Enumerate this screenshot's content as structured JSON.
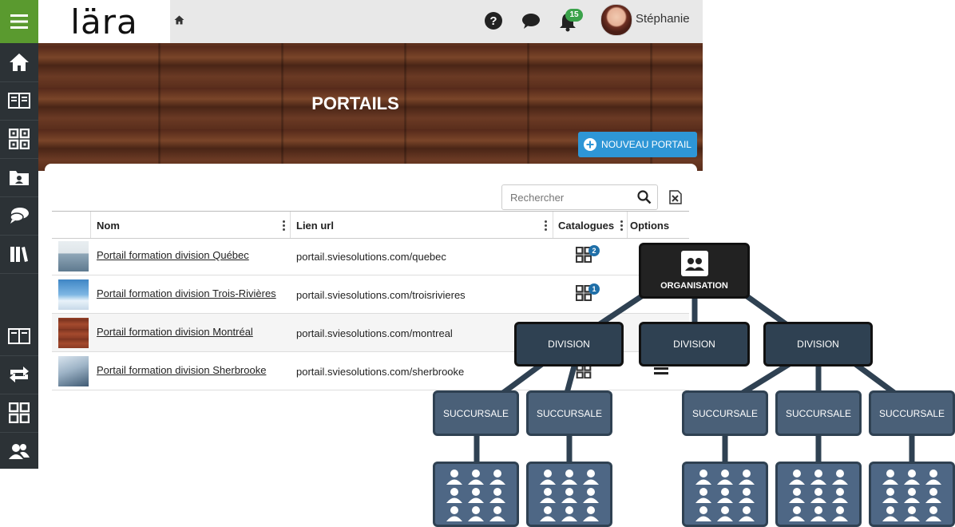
{
  "app": {
    "logo_text": "lära"
  },
  "header": {
    "user_name": "Stéphanie",
    "notification_count": "15"
  },
  "banner": {
    "title": "PORTAILS"
  },
  "toolbar": {
    "new_portal_label": "NOUVEAU PORTAIL"
  },
  "search": {
    "placeholder": "Rechercher"
  },
  "table": {
    "columns": {
      "name": "Nom",
      "url": "Lien url",
      "catalogs": "Catalogues",
      "options": "Options"
    },
    "rows": [
      {
        "name": "Portail formation division Québec",
        "url": "portail.sviesolutions.com/quebec",
        "catalog_count": "2"
      },
      {
        "name": "Portail formation division Trois-Rivières",
        "url": "portail.sviesolutions.com/troisrivieres",
        "catalog_count": "1"
      },
      {
        "name": "Portail formation division Montréal",
        "url": "portail.sviesolutions.com/montreal",
        "catalog_count": ""
      },
      {
        "name": "Portail formation division Sherbrooke",
        "url": "portail.sviesolutions.com/sherbrooke",
        "catalog_count": ""
      }
    ]
  },
  "org_chart": {
    "root": "ORGANISATION",
    "divisions": [
      "DIVISION",
      "DIVISION",
      "DIVISION"
    ],
    "branches": [
      "SUCCURSALE",
      "SUCCURSALE",
      "SUCCURSALE",
      "SUCCURSALE",
      "SUCCURSALE"
    ]
  },
  "colors": {
    "menu_green": "#5a9a2f",
    "accent_blue": "#2e96d6",
    "sidebar": "#2c3236",
    "node_dark": "#2f4152"
  }
}
